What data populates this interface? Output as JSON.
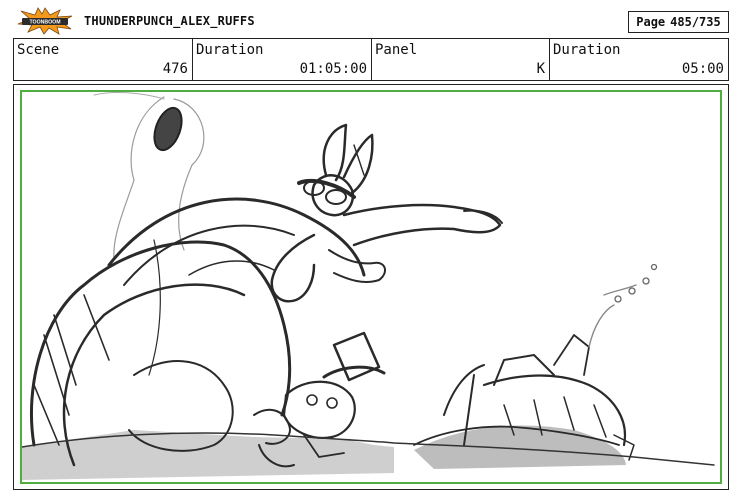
{
  "header": {
    "logo_icon": "toonboom-logo-icon",
    "logo_text": "TOONBOOM",
    "project_title": "THUNDERPUNCH_ALEX_RUFFS",
    "page_label": "Page",
    "page_value": "485/735"
  },
  "info": {
    "scene_label": "Scene",
    "scene_value": "476",
    "scene_duration_label": "Duration",
    "scene_duration_value": "01:05:00",
    "panel_label": "Panel",
    "panel_value": "K",
    "panel_duration_label": "Duration",
    "panel_duration_value": "05:00"
  },
  "colors": {
    "safe_frame": "#4fae3e",
    "logo_orange": "#f39a1d",
    "sketch_gray": "#c8c8c8"
  }
}
